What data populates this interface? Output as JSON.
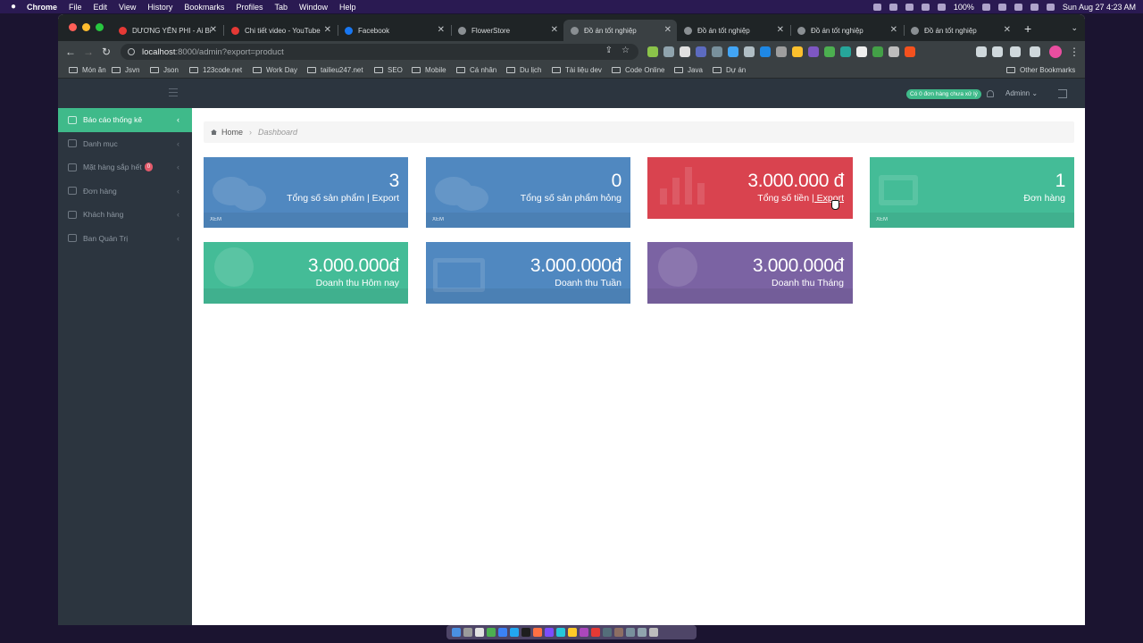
{
  "menubar": {
    "app": "Chrome",
    "menus": [
      "File",
      "Edit",
      "View",
      "History",
      "Bookmarks",
      "Profiles",
      "Tab",
      "Window",
      "Help"
    ],
    "battery": "100%",
    "datetime": "Sun Aug 27  4:23 AM"
  },
  "tabs": [
    {
      "title": "DƯƠNG YẾN PHI - Ai Bi",
      "color": "#e53935"
    },
    {
      "title": "Chi tiết video - YouTube",
      "color": "#e53935"
    },
    {
      "title": "Facebook",
      "color": "#1877f2"
    },
    {
      "title": "FlowerStore",
      "color": "#8a8f93"
    },
    {
      "title": "Đồ án tốt nghiệp",
      "color": "#8a8f93"
    },
    {
      "title": "Đồ án tốt nghiệp",
      "color": "#8a8f93"
    },
    {
      "title": "Đồ án tốt nghiệp",
      "color": "#8a8f93"
    },
    {
      "title": "Đồ án tốt nghiệp",
      "color": "#8a8f93"
    }
  ],
  "omnibox": {
    "host": "localhost",
    "path": ":8000/admin?export=product"
  },
  "bookmarks": [
    "Món ăn",
    "Jsvn",
    "Json",
    "123code.net",
    "Work Day",
    "tailieu247.net",
    "SEO",
    "Mobile",
    "Cá nhân",
    "Du lịch",
    "Tài liệu dev",
    "Code Online",
    "Java",
    "Dự án"
  ],
  "other_bookmarks": "Other Bookmarks",
  "topbar": {
    "notice": "Có 0 đơn hàng chưa xử lý",
    "admin": "Adminn"
  },
  "sidebar": [
    {
      "label": "Báo cáo thống kê",
      "active": true
    },
    {
      "label": "Danh mục"
    },
    {
      "label": "Mặt hàng sắp hết",
      "badge": "0"
    },
    {
      "label": "Đơn hàng"
    },
    {
      "label": "Khách hàng"
    },
    {
      "label": "Ban Quản Trị"
    }
  ],
  "breadcrumb": {
    "home": "Home",
    "current": "Dashboard"
  },
  "tiles": [
    {
      "value": "3",
      "label": "Tổng số sản phẩm",
      "link": "| Export",
      "footer": "XEM",
      "color": "#5088c0"
    },
    {
      "value": "0",
      "label": "Tổng số sản phẩm hỏng",
      "footer": "XEM",
      "color": "#5088c0"
    },
    {
      "value": "3.000.000 đ",
      "label": "Tổng số tiền ",
      "link": "| Export",
      "color": "#d9434f"
    },
    {
      "value": "1",
      "label": "Đơn hàng",
      "footer": "XEM",
      "color": "#44bc97"
    },
    {
      "value": "3.000.000đ",
      "label": "Doanh thu Hôm nay",
      "color": "#44bc97"
    },
    {
      "value": "3.000.000đ",
      "label": "Doanh thu Tuần",
      "color": "#5088c0"
    },
    {
      "value": "3.000.000đ",
      "label": "Doanh thu Tháng",
      "color": "#7b63a3"
    }
  ]
}
